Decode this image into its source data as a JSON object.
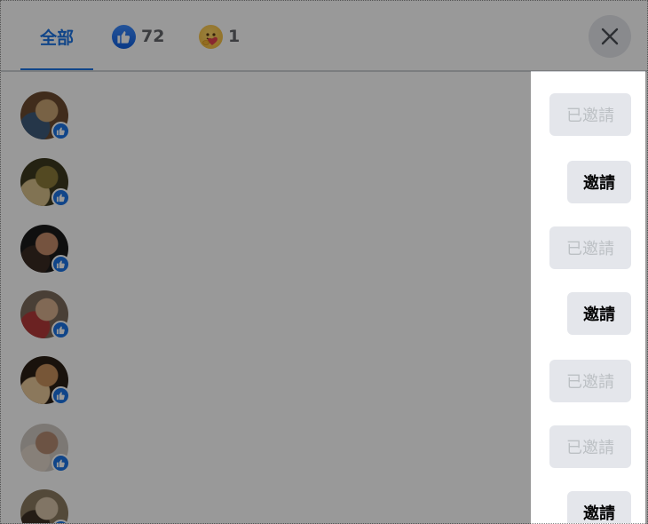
{
  "tabs": {
    "all_label": "全部",
    "like_count": "72",
    "care_count": "1"
  },
  "rows": [
    {
      "button_label": "已邀請",
      "state": "invited",
      "avatar_colors": [
        "#6b4a2f",
        "#c9a474",
        "#3e5a7a"
      ]
    },
    {
      "button_label": "邀請",
      "state": "invite",
      "avatar_colors": [
        "#3c3a1e",
        "#8a7a3a",
        "#d8c08a"
      ]
    },
    {
      "button_label": "已邀請",
      "state": "invited",
      "avatar_colors": [
        "#1a1a1a",
        "#c48a6a",
        "#3a2a22"
      ]
    },
    {
      "button_label": "邀請",
      "state": "invite",
      "avatar_colors": [
        "#7a6a5a",
        "#d7b08e",
        "#b23a3a"
      ]
    },
    {
      "button_label": "已邀請",
      "state": "invited",
      "avatar_colors": [
        "#2b1e14",
        "#c7905c",
        "#e8c89a"
      ]
    },
    {
      "button_label": "已邀請",
      "state": "invited",
      "avatar_colors": [
        "#cfc8c2",
        "#b48a72",
        "#e2d6ca"
      ]
    },
    {
      "button_label": "邀請",
      "state": "invite",
      "avatar_colors": [
        "#8a7a60",
        "#d8c4a8",
        "#3c3024"
      ]
    }
  ],
  "colors": {
    "accent": "#1b74e4",
    "overlay": "rgba(0,0,0,0.40)",
    "button_bg": "#e4e6eb"
  },
  "icons": {
    "like": "thumbs-up-icon",
    "care": "care-hug-icon",
    "close": "close-icon",
    "badge": "like-badge-icon"
  }
}
